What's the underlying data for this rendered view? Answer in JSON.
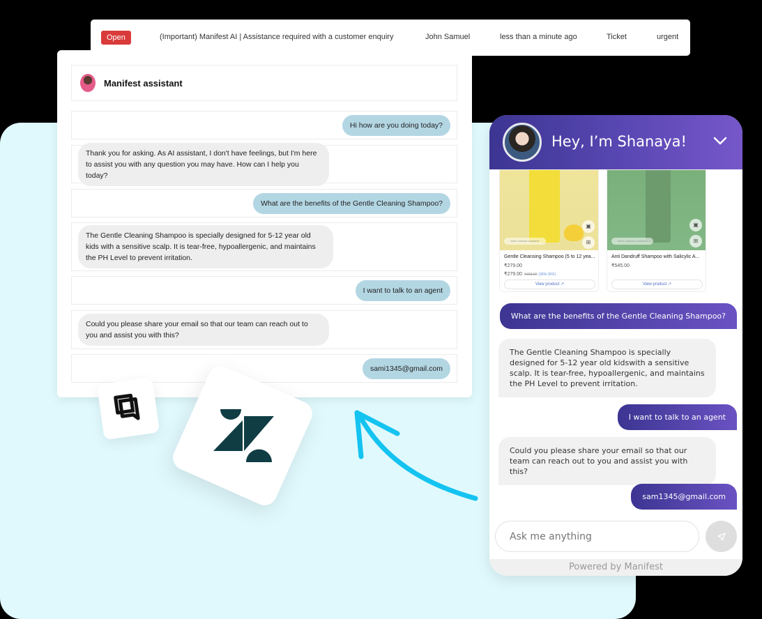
{
  "ticket": {
    "status": "Open",
    "subject": "(Important) Manifest AI | Assistance required with a customer enquiry",
    "requester": "John Samuel",
    "time": "less than a minute ago",
    "type": "Ticket",
    "priority": "urgent",
    "status_color": "#d93b3b"
  },
  "agent_panel": {
    "title": "Manifest assistant",
    "messages": [
      {
        "role": "user",
        "text": "Hi how are you doing today?"
      },
      {
        "role": "bot",
        "text": "Thank you for asking. As AI assistant, I don't have feelings, but I'm here to assist you with any question you may have. How can I help you today?"
      },
      {
        "role": "user",
        "text": "What are the benefits of the Gentle Cleaning Shampoo?"
      },
      {
        "role": "bot",
        "text": "The Gentle Cleaning Shampoo is specially designed for 5-12 year old kids with a sensitive scalp. It is tear-free, hypoallergenic, and maintains the PH Level to prevent irritation."
      },
      {
        "role": "user",
        "text": "I want to talk to an agent"
      },
      {
        "role": "bot",
        "text": "Could you please share your email so that our team can reach out to you and assist you with this?"
      },
      {
        "role": "user",
        "text": "sami1345@gmail.com"
      }
    ]
  },
  "logos": {
    "small": "chat-bubbles-logo",
    "big": "zendesk-logo"
  },
  "widget": {
    "title": "Hey, I’m Shanaya!",
    "brand_color": "#4a3fa6",
    "products": [
      {
        "name": "Gentle Cleansing Shampoo (5 to 12 yea...",
        "price": "₹279.00",
        "sale_price": "₹279.00",
        "original_price": "₹399.00",
        "discount": "(30% OFF)",
        "variant_label": "More variants available",
        "view_label": "View product"
      },
      {
        "name": "Anti Dandruff Shampoo with Salicylic A...",
        "price": "₹545.00",
        "variant_label": "More variants available",
        "view_label": "View product"
      }
    ],
    "messages": [
      {
        "role": "user",
        "text": "What are the benefits of the Gentle Cleaning Shampoo?"
      },
      {
        "role": "bot",
        "text": "The Gentle Cleaning Shampoo is specially designed for 5-12 year old kidswith a sensitive scalp. It is tear-free, hypoallergenic, and maintains the PH Level to prevent irritation."
      },
      {
        "role": "user",
        "text": "I want to talk to an agent"
      },
      {
        "role": "bot",
        "text": "Could you please share your email so that our team can reach out to you and assist you with this?"
      },
      {
        "role": "user",
        "text": "sam1345@gmail.com"
      }
    ],
    "input_placeholder": "Ask me anything",
    "footer": "Powered by Manifest"
  }
}
